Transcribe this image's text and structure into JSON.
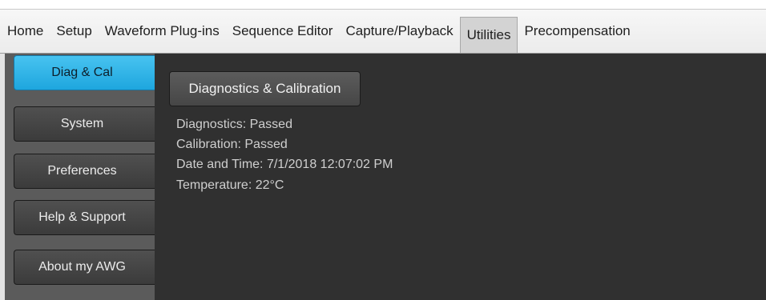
{
  "tabs": [
    {
      "label": "Home",
      "active": false
    },
    {
      "label": "Setup",
      "active": false
    },
    {
      "label": "Waveform Plug-ins",
      "active": false
    },
    {
      "label": "Sequence Editor",
      "active": false
    },
    {
      "label": "Capture/Playback",
      "active": false
    },
    {
      "label": "Utilities",
      "active": true
    },
    {
      "label": "Precompensation",
      "active": false
    }
  ],
  "sidebar": {
    "items": [
      {
        "label": "Diag & Cal",
        "active": true
      },
      {
        "label": "System",
        "active": false
      },
      {
        "label": "Preferences",
        "active": false
      },
      {
        "label": "Help & Support",
        "active": false
      },
      {
        "label": "About my AWG",
        "active": false
      }
    ]
  },
  "main": {
    "button_label": "Diagnostics & Calibration",
    "status": {
      "diagnostics": "Diagnostics: Passed",
      "calibration": "Calibration:  Passed",
      "datetime": "Date and Time:  7/1/2018 12:07:02 PM",
      "temperature": "Temperature:  22°C"
    }
  },
  "colors": {
    "accent_active": "#1ea6de",
    "main_background": "#303030",
    "sidebar_background": "#5b5b5b"
  }
}
